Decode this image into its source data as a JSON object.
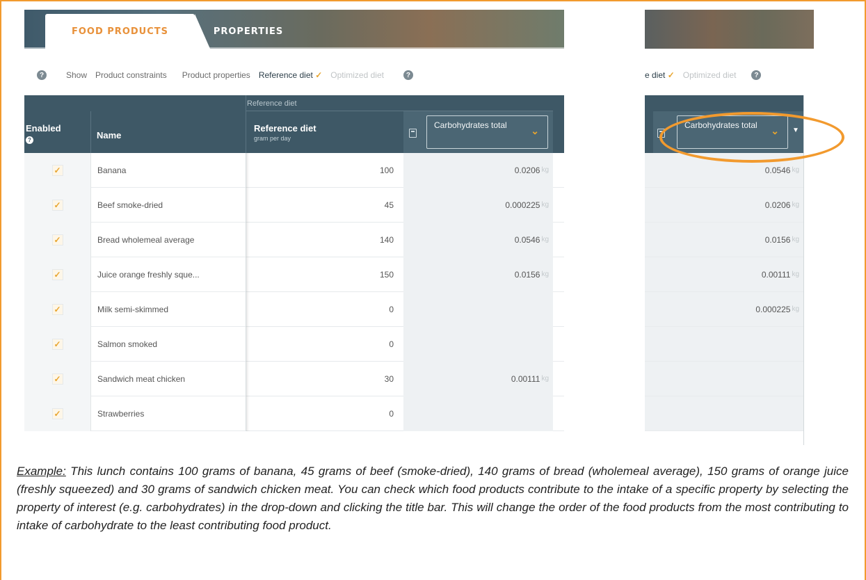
{
  "tabs": {
    "food_products": "FOOD PRODUCTS",
    "properties": "PROPERTIES"
  },
  "toolbar": {
    "help": "?",
    "show": "Show",
    "product_constraints": "Product constraints",
    "product_properties": "Product properties",
    "reference_diet": "Reference diet",
    "optimized_diet": "Optimized diet",
    "check": "✓"
  },
  "table": {
    "group_label": "Reference diet",
    "headers": {
      "enabled": "Enabled",
      "enabled_help": "?",
      "name": "Name",
      "reference_diet": "Reference diet",
      "reference_unit": "gram per day",
      "property_select": "Carbohydrates total"
    },
    "unit": "kg",
    "rows": [
      {
        "name": "Banana",
        "ref": "100",
        "value": "0.0206"
      },
      {
        "name": "Beef smoke-dried",
        "ref": "45",
        "value": "0.000225"
      },
      {
        "name": "Bread wholemeal average",
        "ref": "140",
        "value": "0.0546"
      },
      {
        "name": "Juice orange freshly sque...",
        "ref": "150",
        "value": "0.0156"
      },
      {
        "name": "Milk semi-skimmed",
        "ref": "0",
        "value": ""
      },
      {
        "name": "Salmon smoked",
        "ref": "0",
        "value": ""
      },
      {
        "name": "Sandwich meat chicken",
        "ref": "30",
        "value": "0.00111"
      },
      {
        "name": "Strawberries",
        "ref": "0",
        "value": ""
      }
    ]
  },
  "right_panel": {
    "toolbar_diet": "e diet",
    "optimized_diet": "Optimized diet",
    "property_select": "Carbohydrates total",
    "sorted_values": [
      "0.0546",
      "0.0206",
      "0.0156",
      "0.00111",
      "0.000225"
    ]
  },
  "caption": {
    "example_label": "Example:",
    "text": " This lunch contains 100 grams of banana, 45 grams of beef (smoke-dried), 140 grams of bread (wholemeal average), 150 grams of orange juice (freshly squeezed) and 30 grams of sandwich chicken meat. You can check which food products contribute to the intake of a specific property by selecting the property of interest (e.g. carbohydrates) in the drop-down and clicking the title bar. This will change the order of the food products from the most contributing to intake of carbohydrate to the least contributing food product."
  },
  "colors": {
    "accent": "#f29a2e",
    "header": "#3e5866",
    "check": "#e8a52e"
  }
}
